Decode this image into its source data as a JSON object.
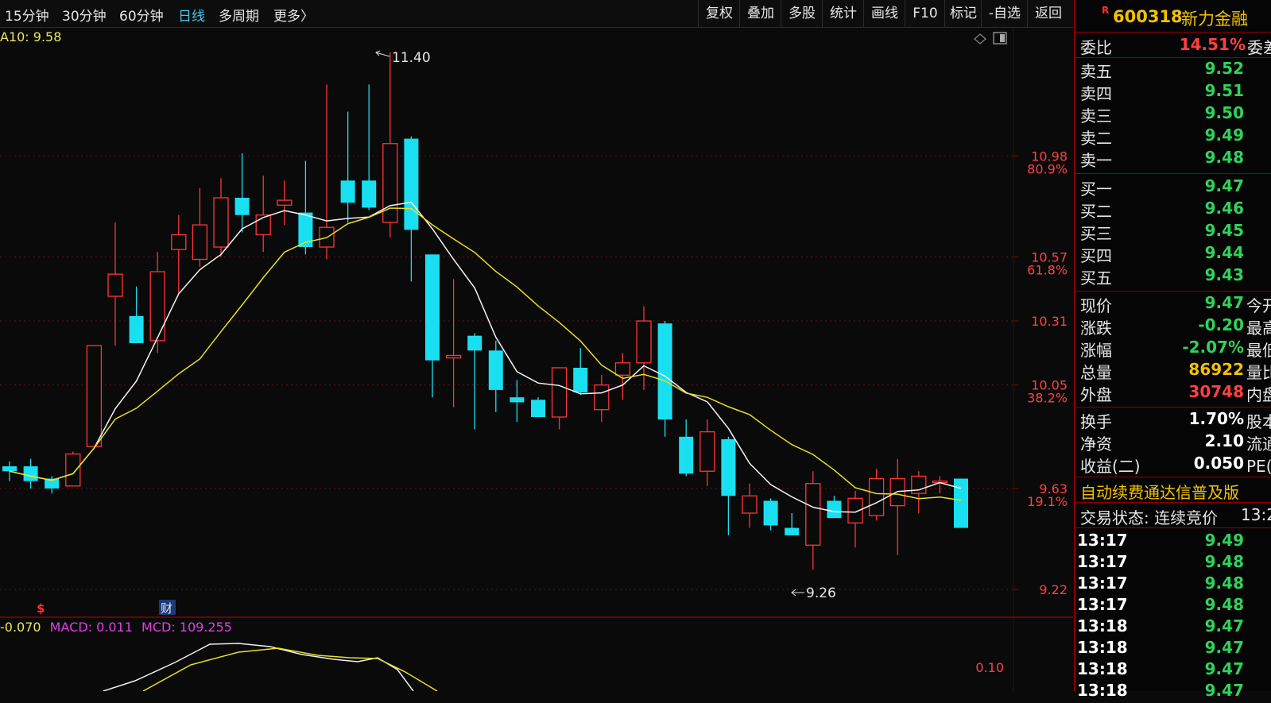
{
  "toolbar": {
    "tabs": [
      {
        "label": "15分钟",
        "active": false
      },
      {
        "label": "30分钟",
        "active": false
      },
      {
        "label": "60分钟",
        "active": false
      },
      {
        "label": "日线",
        "active": true
      },
      {
        "label": "多周期",
        "active": false
      },
      {
        "label": "更多〉",
        "active": false
      }
    ],
    "tools": [
      "复权",
      "叠加",
      "多股",
      "统计",
      "画线",
      "F10",
      "标记",
      "-自选",
      "返回"
    ]
  },
  "chart": {
    "ma_label": "A10: 9.58",
    "high_label": "11.40",
    "low_label": "9.26",
    "price_ticks": [
      "10.98",
      "10.57",
      "10.31",
      "10.05",
      "9.63",
      "9.22"
    ],
    "fib_ticks": [
      "80.9%",
      "61.8%",
      "38.2%",
      "19.1%"
    ],
    "markers": {
      "dollar": "$",
      "cai": "财"
    },
    "macd_labels": [
      {
        "text": "-0.070",
        "color": "#e8e858"
      },
      {
        "text": "MACD: 0.011",
        "color": "#e040e0"
      },
      {
        "text": "MCD: 109.255",
        "color": "#e040e0"
      }
    ],
    "macd_tick": "0.10"
  },
  "chart_data": {
    "type": "candlestick",
    "candles": [
      {
        "o": 9.72,
        "h": 9.74,
        "l": 9.66,
        "c": 9.7
      },
      {
        "o": 9.72,
        "h": 9.75,
        "l": 9.63,
        "c": 9.66
      },
      {
        "o": 9.67,
        "h": 9.68,
        "l": 9.61,
        "c": 9.63
      },
      {
        "o": 9.64,
        "h": 9.78,
        "l": 9.64,
        "c": 9.77
      },
      {
        "o": 9.8,
        "h": 10.21,
        "l": 9.79,
        "c": 10.21
      },
      {
        "o": 10.41,
        "h": 10.71,
        "l": 10.21,
        "c": 10.5
      },
      {
        "o": 10.33,
        "h": 10.45,
        "l": 10.24,
        "c": 10.22
      },
      {
        "o": 10.23,
        "h": 10.59,
        "l": 10.18,
        "c": 10.51
      },
      {
        "o": 10.6,
        "h": 10.74,
        "l": 10.42,
        "c": 10.66
      },
      {
        "o": 10.56,
        "h": 10.85,
        "l": 10.53,
        "c": 10.7
      },
      {
        "o": 10.61,
        "h": 10.89,
        "l": 10.57,
        "c": 10.81
      },
      {
        "o": 10.81,
        "h": 10.99,
        "l": 10.67,
        "c": 10.74
      },
      {
        "o": 10.66,
        "h": 10.9,
        "l": 10.59,
        "c": 10.74
      },
      {
        "o": 10.78,
        "h": 10.88,
        "l": 10.7,
        "c": 10.8
      },
      {
        "o": 10.75,
        "h": 10.96,
        "l": 10.58,
        "c": 10.61
      },
      {
        "o": 10.61,
        "h": 11.27,
        "l": 10.56,
        "c": 10.69
      },
      {
        "o": 10.88,
        "h": 11.16,
        "l": 10.71,
        "c": 10.79
      },
      {
        "o": 10.88,
        "h": 11.27,
        "l": 10.76,
        "c": 10.77
      },
      {
        "o": 10.71,
        "h": 11.4,
        "l": 10.65,
        "c": 11.03
      },
      {
        "o": 11.05,
        "h": 11.06,
        "l": 10.47,
        "c": 10.68
      },
      {
        "o": 10.58,
        "h": 10.58,
        "l": 10.0,
        "c": 10.15
      },
      {
        "o": 10.16,
        "h": 10.48,
        "l": 9.96,
        "c": 10.17
      },
      {
        "o": 10.25,
        "h": 10.26,
        "l": 9.87,
        "c": 10.19
      },
      {
        "o": 10.19,
        "h": 10.23,
        "l": 9.94,
        "c": 10.03
      },
      {
        "o": 10.0,
        "h": 10.07,
        "l": 9.9,
        "c": 9.98
      },
      {
        "o": 9.99,
        "h": 10.0,
        "l": 9.92,
        "c": 9.92
      },
      {
        "o": 9.92,
        "h": 10.1,
        "l": 9.87,
        "c": 10.12
      },
      {
        "o": 10.12,
        "h": 10.2,
        "l": 10.01,
        "c": 10.02
      },
      {
        "o": 9.95,
        "h": 10.09,
        "l": 9.9,
        "c": 10.05
      },
      {
        "o": 10.09,
        "h": 10.18,
        "l": 9.99,
        "c": 10.14
      },
      {
        "o": 10.14,
        "h": 10.37,
        "l": 10.03,
        "c": 10.31
      },
      {
        "o": 10.3,
        "h": 10.31,
        "l": 9.84,
        "c": 9.91
      },
      {
        "o": 9.84,
        "h": 9.91,
        "l": 9.68,
        "c": 9.69
      },
      {
        "o": 9.7,
        "h": 9.91,
        "l": 9.64,
        "c": 9.86
      },
      {
        "o": 9.83,
        "h": 9.84,
        "l": 9.44,
        "c": 9.6
      },
      {
        "o": 9.53,
        "h": 9.65,
        "l": 9.47,
        "c": 9.6
      },
      {
        "o": 9.58,
        "h": 9.59,
        "l": 9.46,
        "c": 9.48
      },
      {
        "o": 9.47,
        "h": 9.53,
        "l": 9.44,
        "c": 9.44
      },
      {
        "o": 9.4,
        "h": 9.7,
        "l": 9.3,
        "c": 9.65
      },
      {
        "o": 9.58,
        "h": 9.6,
        "l": 9.51,
        "c": 9.51
      },
      {
        "o": 9.49,
        "h": 9.62,
        "l": 9.39,
        "c": 9.59
      },
      {
        "o": 9.52,
        "h": 9.71,
        "l": 9.5,
        "c": 9.67
      },
      {
        "o": 9.56,
        "h": 9.75,
        "l": 9.36,
        "c": 9.67
      },
      {
        "o": 9.61,
        "h": 9.7,
        "l": 9.53,
        "c": 9.68
      },
      {
        "o": 9.66,
        "h": 9.68,
        "l": 9.61,
        "c": 9.66
      },
      {
        "o": 9.67,
        "h": 9.67,
        "l": 9.47,
        "c": 9.47
      }
    ],
    "ylim": [
      9.13,
      11.5
    ]
  },
  "quote": {
    "code": "600318",
    "name": "新力金融",
    "badge": "R",
    "weibi_label": "委比",
    "weibi_value": "14.51%",
    "weicha_label": "委差",
    "sells": [
      {
        "label": "卖五",
        "price": "9.52"
      },
      {
        "label": "卖四",
        "price": "9.51"
      },
      {
        "label": "卖三",
        "price": "9.50"
      },
      {
        "label": "卖二",
        "price": "9.49"
      },
      {
        "label": "卖一",
        "price": "9.48"
      }
    ],
    "buys": [
      {
        "label": "买一",
        "price": "9.47"
      },
      {
        "label": "买二",
        "price": "9.46"
      },
      {
        "label": "买三",
        "price": "9.45"
      },
      {
        "label": "买四",
        "price": "9.44"
      },
      {
        "label": "买五",
        "price": "9.43"
      }
    ],
    "stats": [
      {
        "label": "现价",
        "value": "9.47",
        "color": "green",
        "label2": "今开"
      },
      {
        "label": "涨跌",
        "value": "-0.20",
        "color": "green",
        "label2": "最高"
      },
      {
        "label": "涨幅",
        "value": "-2.07%",
        "color": "green",
        "label2": "最低"
      },
      {
        "label": "总量",
        "value": "86922",
        "color": "yellow",
        "label2": "量比"
      },
      {
        "label": "外盘",
        "value": "30748",
        "color": "red",
        "label2": "内盘"
      }
    ],
    "stats2": [
      {
        "label": "换手",
        "value": "1.70%",
        "label2": "股本"
      },
      {
        "label": "净资",
        "value": "2.10",
        "label2": "流通"
      },
      {
        "label": "收益(二)",
        "value": "0.050",
        "label2": "PE(动)"
      }
    ],
    "banner": "自动续费通达信普及版",
    "status_label": "交易状态: 连续竞价",
    "status_time": "13:2",
    "ticks": [
      {
        "time": "13:17",
        "price": "9.49"
      },
      {
        "time": "13:17",
        "price": "9.48"
      },
      {
        "time": "13:17",
        "price": "9.48"
      },
      {
        "time": "13:17",
        "price": "9.48"
      },
      {
        "time": "13:18",
        "price": "9.47"
      },
      {
        "time": "13:18",
        "price": "9.47"
      },
      {
        "time": "13:18",
        "price": "9.47"
      },
      {
        "time": "13:18",
        "price": "9.47"
      }
    ]
  }
}
